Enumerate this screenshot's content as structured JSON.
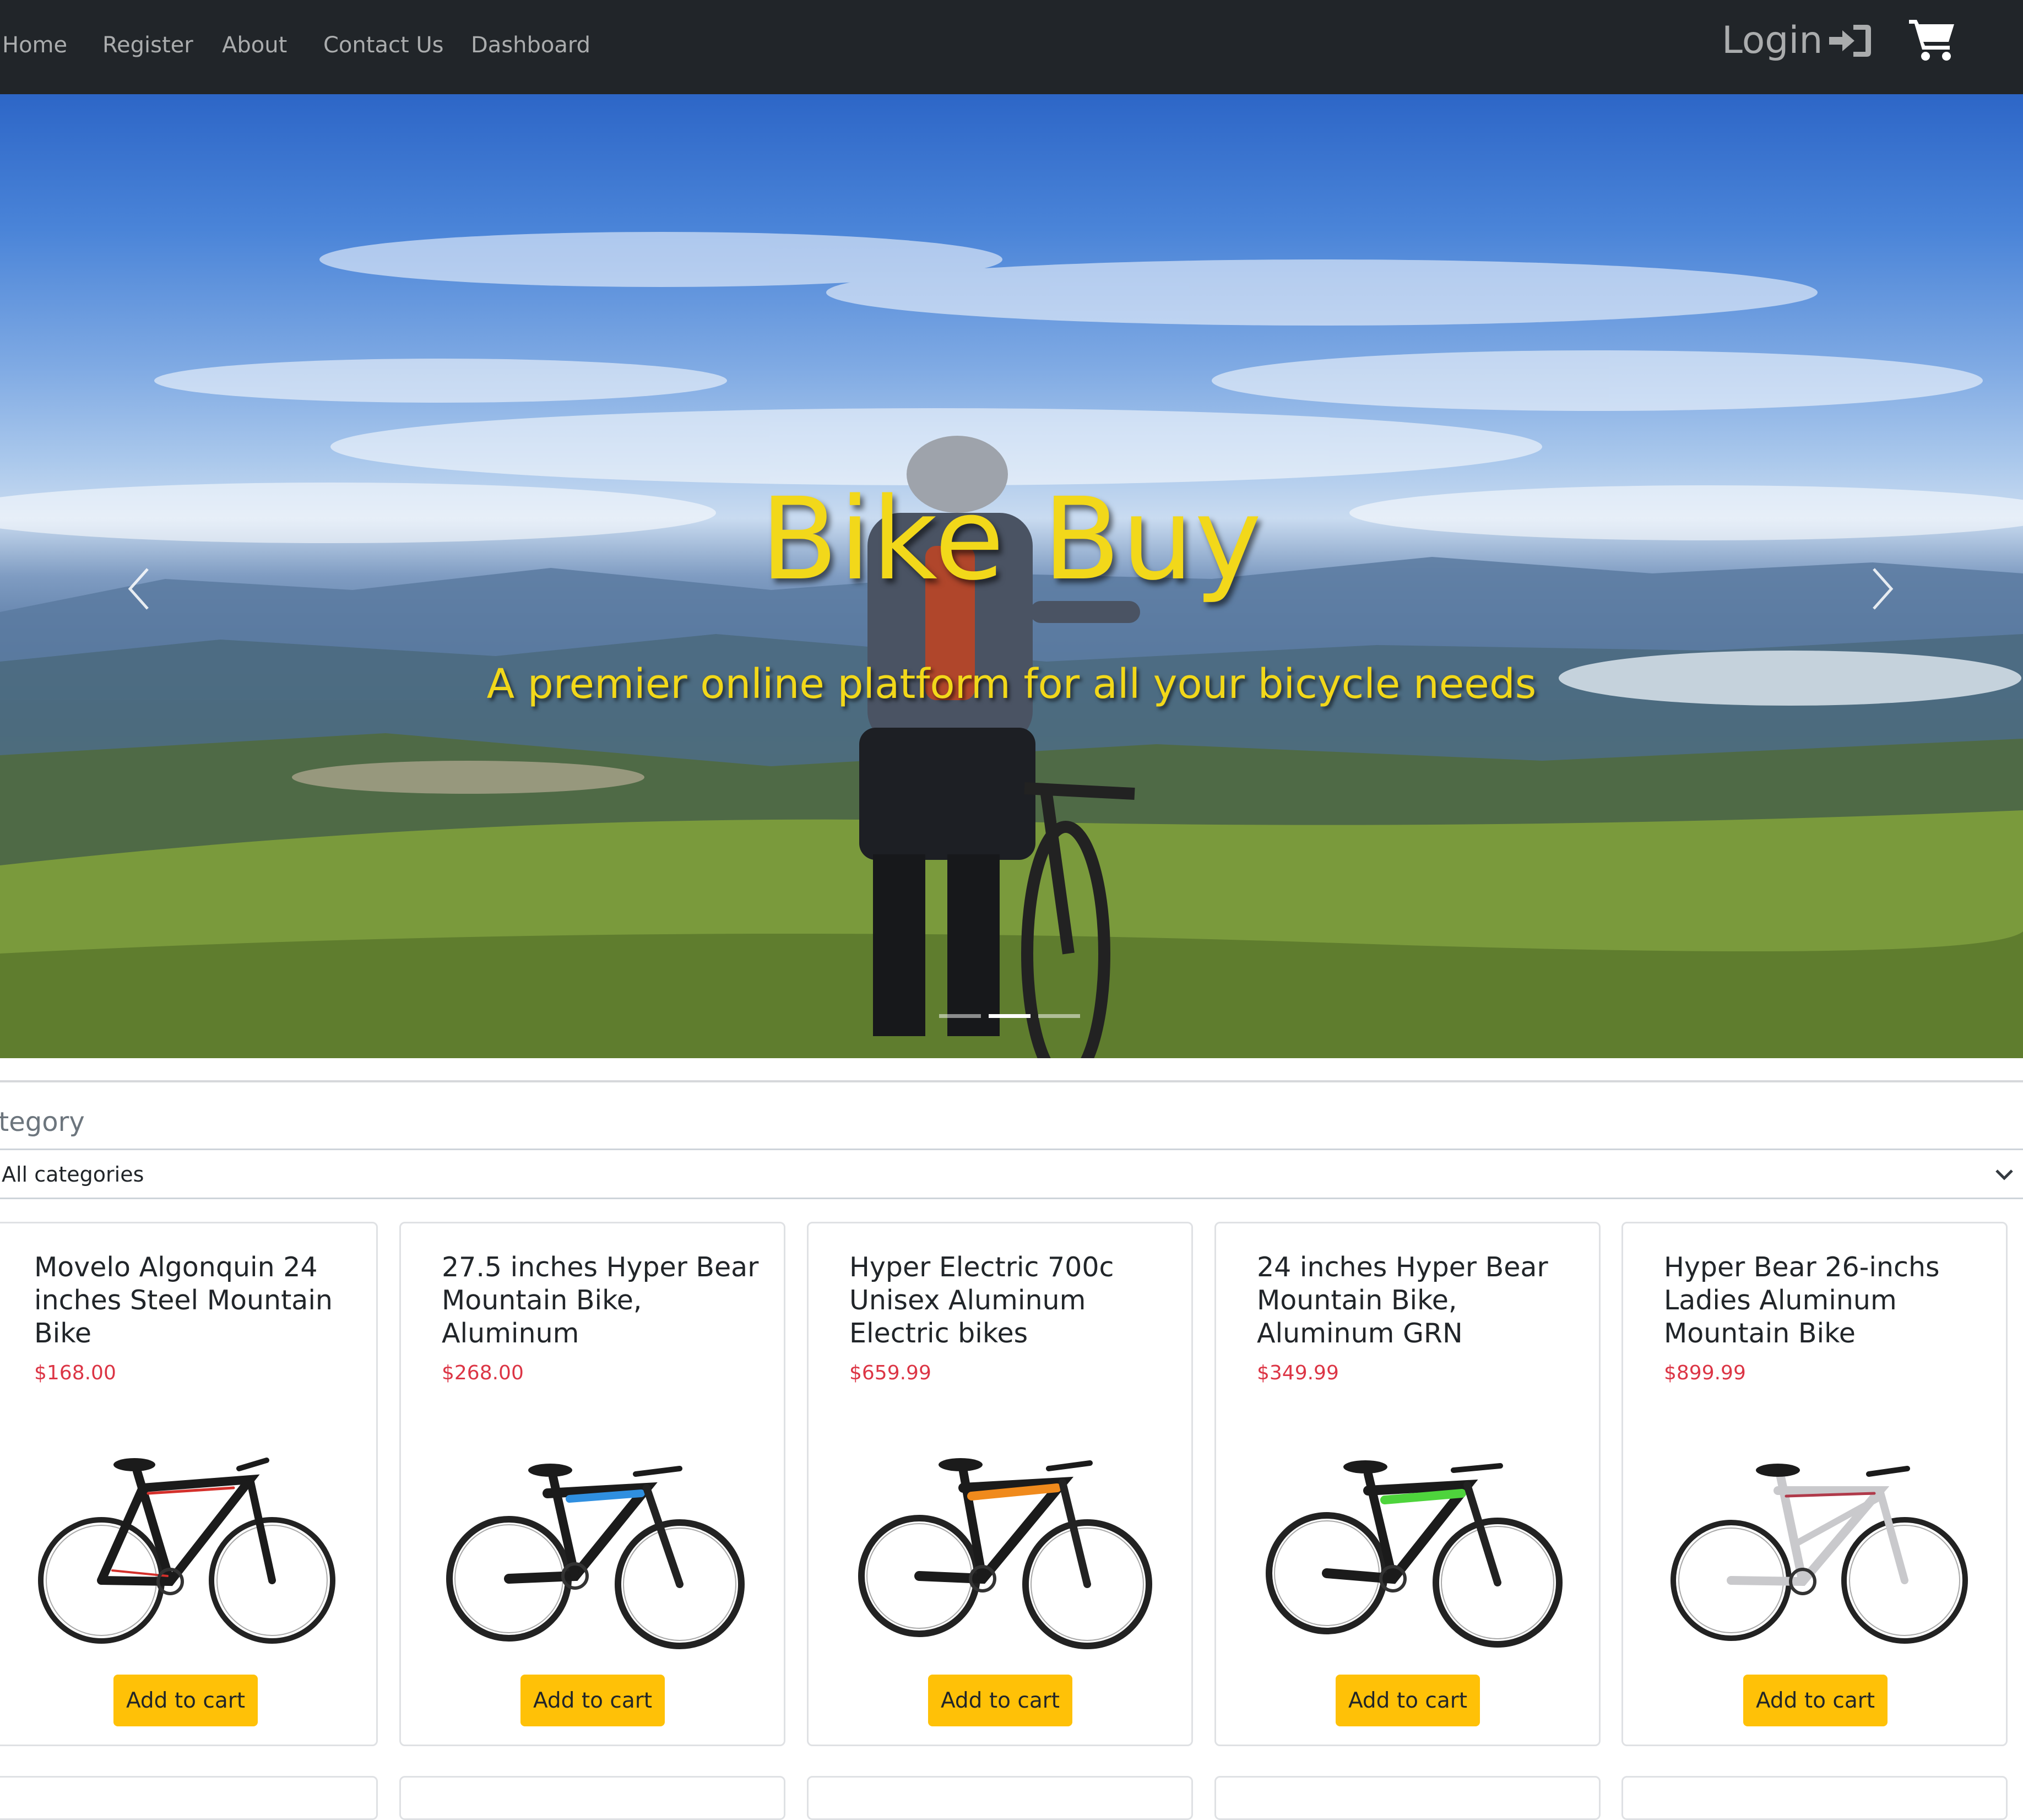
{
  "nav": {
    "links": [
      "Home",
      "Register",
      "About",
      "Contact Us",
      "Dashboard"
    ],
    "login_label": "Login",
    "login_icon": "sign-in-icon",
    "cart_icon": "shopping-cart-icon",
    "background_color": "#212529"
  },
  "hero": {
    "title": "Bike Buy",
    "subtitle": "A premier online platform for all your bicycle needs",
    "text_color": "#f2d81a",
    "prev_icon": "chevron-left-icon",
    "next_icon": "chevron-right-icon",
    "slide_count": 3,
    "active_slide": 2
  },
  "filter": {
    "label": "ategory",
    "selected": "All categories"
  },
  "products": [
    {
      "title": "Movelo Algonquin 24 inches Steel Mountain Bike",
      "price": "$168.00",
      "button": "Add to cart",
      "frame_color": "#1b1b1b",
      "accent_color": "#d4302b"
    },
    {
      "title": "27.5 inches Hyper Bear Mountain Bike, Aluminum",
      "price": "$268.00",
      "button": "Add to cart",
      "frame_color": "#1b1b1b",
      "accent_color": "#2f8fe0"
    },
    {
      "title": "Hyper Electric 700c Unisex Aluminum Electric bikes",
      "price": "$659.99",
      "button": "Add to cart",
      "frame_color": "#1b1b1b",
      "accent_color": "#f08a1c"
    },
    {
      "title": "24 inches Hyper Bear Mountain Bike, Aluminum GRN",
      "price": "$349.99",
      "button": "Add to cart",
      "frame_color": "#1b1b1b",
      "accent_color": "#4ed43c"
    },
    {
      "title": "Hyper Bear 26-inchs Ladies Aluminum Mountain Bike",
      "price": "$899.99",
      "button": "Add to cart",
      "frame_color": "#c9c9cc",
      "accent_color": "#b03a4a"
    }
  ],
  "colors": {
    "price": "#dc3545",
    "button": "#ffc107"
  }
}
